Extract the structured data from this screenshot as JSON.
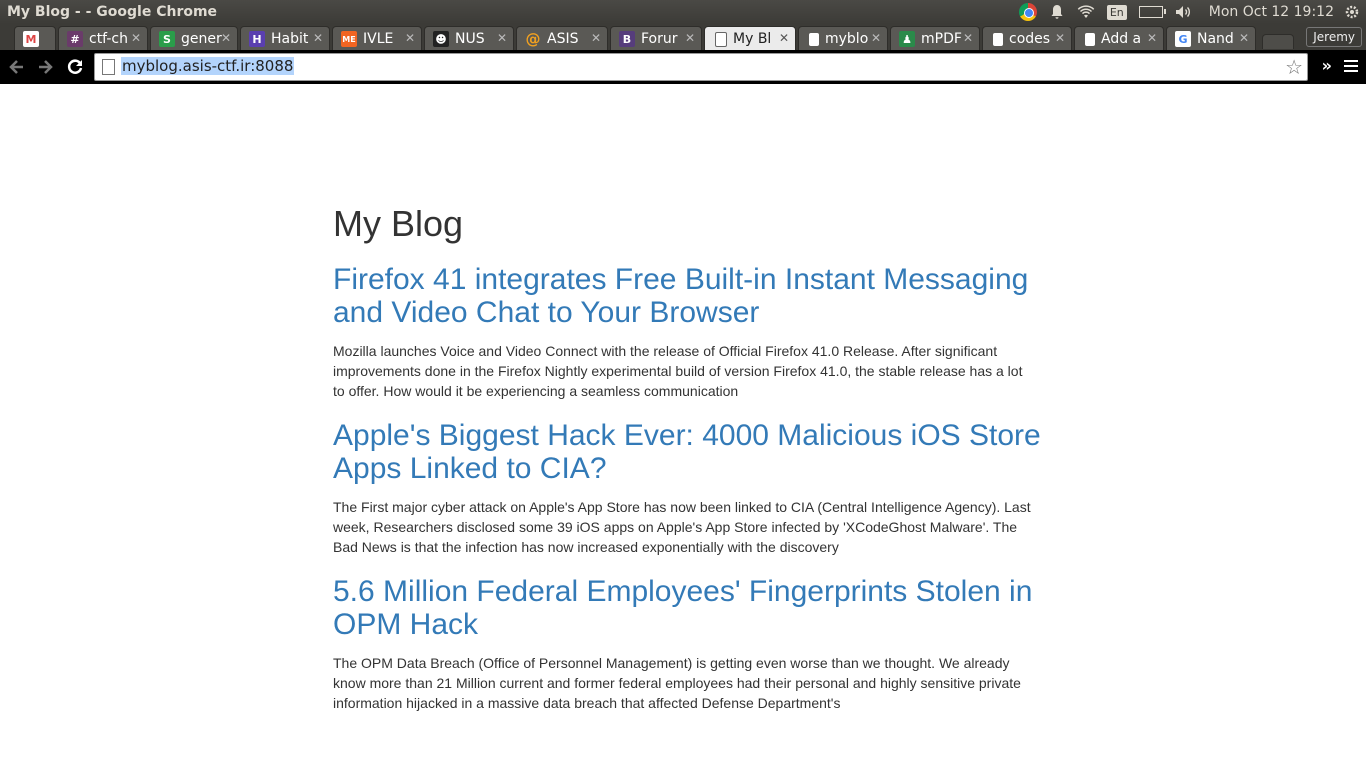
{
  "window": {
    "title": "My Blog - - Google Chrome"
  },
  "system": {
    "language": "En",
    "clock": "Mon Oct 12 19:12",
    "icons": [
      "chrome-icon",
      "bell-icon",
      "wifi-icon",
      "battery-icon",
      "volume-icon",
      "gear-icon"
    ]
  },
  "tabs": [
    {
      "label": "",
      "icon": "gmail-icon",
      "active": false
    },
    {
      "label": "ctf-ch",
      "icon": "slack-icon",
      "active": false
    },
    {
      "label": "gener",
      "icon": "s-icon",
      "active": false
    },
    {
      "label": "Habit",
      "icon": "habit-icon",
      "active": false
    },
    {
      "label": "IVLE",
      "icon": "me-icon",
      "active": false
    },
    {
      "label": "NUS",
      "icon": "nus-icon",
      "active": false
    },
    {
      "label": "ASIS",
      "icon": "at-icon",
      "active": false
    },
    {
      "label": "Forur",
      "icon": "b-icon",
      "active": false
    },
    {
      "label": "My Bl",
      "icon": "page-icon",
      "active": true
    },
    {
      "label": "myblo",
      "icon": "page-icon",
      "active": false
    },
    {
      "label": "mPDF",
      "icon": "mpdf-icon",
      "active": false
    },
    {
      "label": "codes",
      "icon": "page-icon",
      "active": false
    },
    {
      "label": "Add a",
      "icon": "page-icon",
      "active": false
    },
    {
      "label": "Nand",
      "icon": "google-icon",
      "active": false
    }
  ],
  "profile": {
    "name": "Jeremy"
  },
  "toolbar": {
    "url": "myblog.asis-ctf.ir:8088",
    "back_icon": "arrow-left-icon",
    "forward_icon": "arrow-right-icon",
    "reload_icon": "reload-icon",
    "overflow": "»"
  },
  "page": {
    "blog_title": "My Blog",
    "posts": [
      {
        "title": "Firefox 41 integrates Free Built-in Instant Messaging and Video Chat to Your Browser",
        "excerpt": "Mozilla launches Voice and Video Connect with the release of Official Firefox 41.0 Release. After significant improvements done in the Firefox Nightly experimental build of version Firefox 41.0, the stable release has a lot to offer. How would it be experiencing a seamless communication"
      },
      {
        "title": "Apple's Biggest Hack Ever: 4000 Malicious iOS Store Apps Linked to CIA?",
        "excerpt": "The First major cyber attack on Apple's App Store has now been linked to CIA (Central Intelligence Agency). Last week, Researchers disclosed some 39 iOS apps on Apple's App Store infected by 'XCodeGhost Malware'. The Bad News is that the infection has now increased exponentially with the discovery"
      },
      {
        "title": "5.6 Million Federal Employees' Fingerprints Stolen in OPM Hack",
        "excerpt": "The OPM Data Breach (Office of Personnel Management) is getting even worse than we thought. We already know more than 21 Million current and former federal employees had their personal and highly sensitive private information hijacked in a massive data breach that affected Defense Department's"
      }
    ]
  }
}
